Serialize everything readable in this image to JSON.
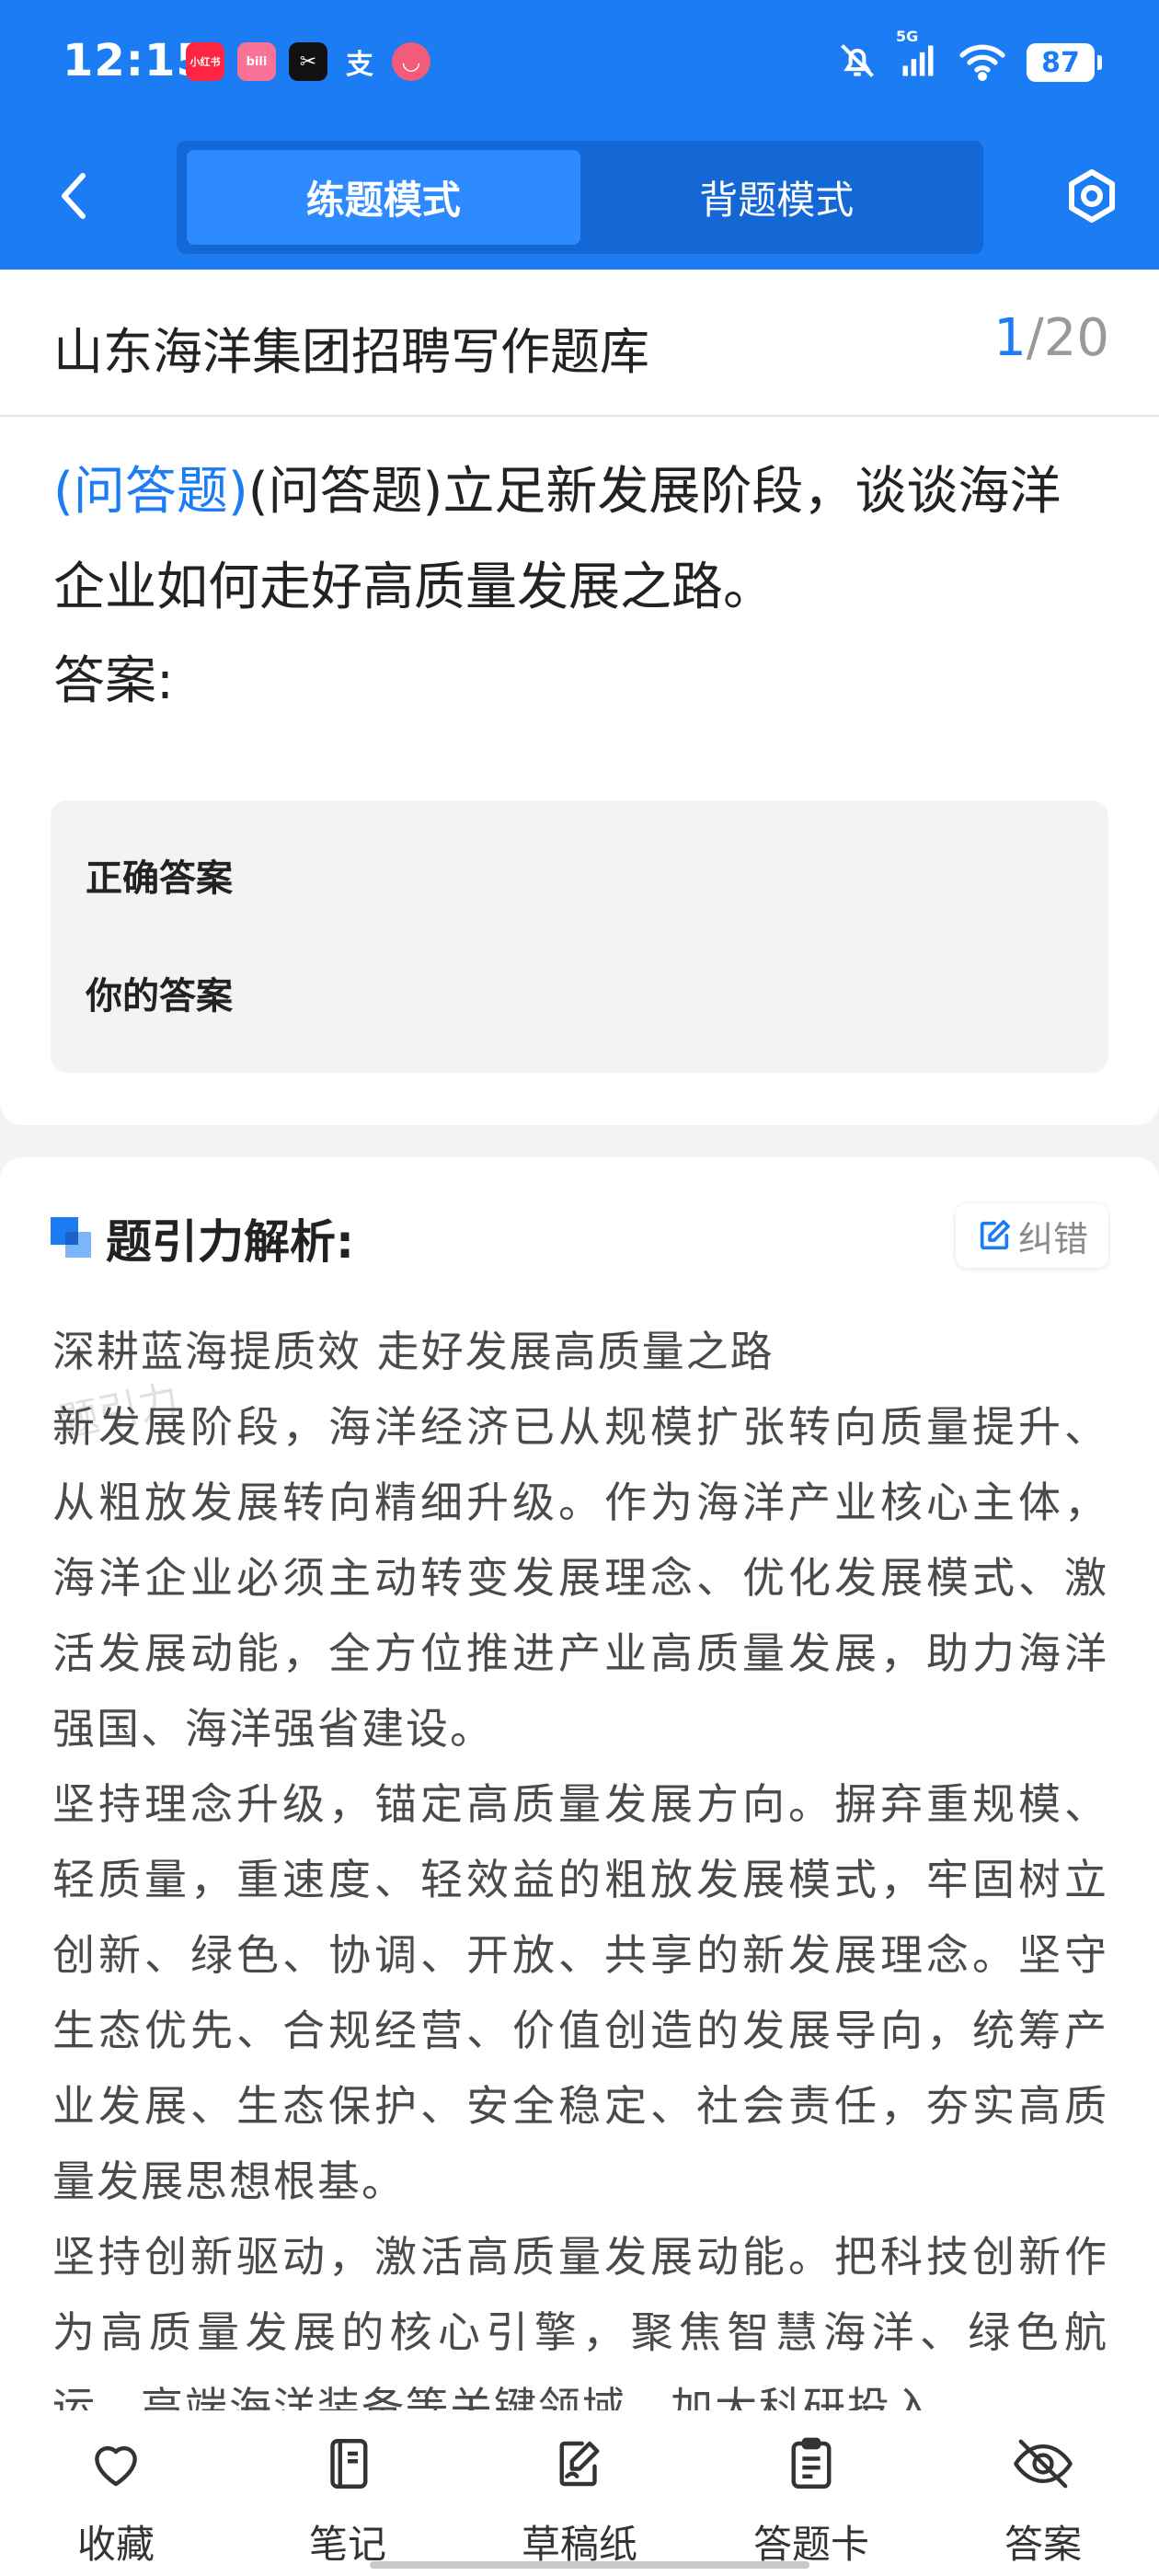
{
  "status_bar": {
    "time": "12:15",
    "app_icons": [
      {
        "name": "xiaohongshu-icon",
        "label": "小红书",
        "color": "#ff2442"
      },
      {
        "name": "bilibili-icon",
        "label": "bili",
        "color": "#fb7299"
      },
      {
        "name": "capcut-icon",
        "label": "✂",
        "color": "#111111"
      },
      {
        "name": "alipay-icon",
        "label": "支",
        "color": "#1b7cf4"
      },
      {
        "name": "message-app-icon",
        "label": "◡",
        "color": "#f25c7a"
      }
    ],
    "network": "5G",
    "battery": "87"
  },
  "nav": {
    "mode_practice": "练题模式",
    "mode_memorize": "背题模式",
    "active_mode": "practice"
  },
  "question": {
    "bank_title": "山东海洋集团招聘写作题库",
    "current": "1",
    "separator": "/",
    "total": "20",
    "type_tag": "(问答题)",
    "text": "(问答题)立足新发展阶段，谈谈海洋企业如何走好高质量发展之路。",
    "answer_label": "答案:",
    "correct_answer_label": "正确答案",
    "your_answer_label": "你的答案"
  },
  "analysis": {
    "title": "题引力解析:",
    "report_label": "纠错",
    "watermark": "题引力",
    "paragraphs": [
      "深耕蓝海提质效 走好发展高质量之路",
      "新发展阶段，海洋经济已从规模扩张转向质量提升、从粗放发展转向精细升级。作为海洋产业核心主体，海洋企业必须主动转变发展理念、优化发展模式、激活发展动能，全方位推进产业高质量发展，助力海洋强国、海洋强省建设。",
      "坚持理念升级，锚定高质量发展方向。摒弃重规模、轻质量，重速度、轻效益的粗放发展模式，牢固树立创新、绿色、协调、开放、共享的新发展理念。坚守生态优先、合规经营、价值创造的发展导向，统筹产业发展、生态保护、安全稳定、社会责任，夯实高质量发展思想根基。",
      "坚持创新驱动，激活高质量发展动能。把科技创新作为高质量发展的核心引擎，聚焦智慧海洋、绿色航运、高端海洋装备等关键领域，加大科研投入"
    ]
  },
  "bottom_nav": [
    {
      "name": "favorite",
      "label": "收藏"
    },
    {
      "name": "notes",
      "label": "笔记"
    },
    {
      "name": "scratch-paper",
      "label": "草稿纸"
    },
    {
      "name": "answer-sheet",
      "label": "答题卡"
    },
    {
      "name": "answer",
      "label": "答案"
    }
  ],
  "colors": {
    "primary": "#1b7cf4",
    "toggle_bg": "#1468d6",
    "toggle_active": "#2e8bff"
  }
}
